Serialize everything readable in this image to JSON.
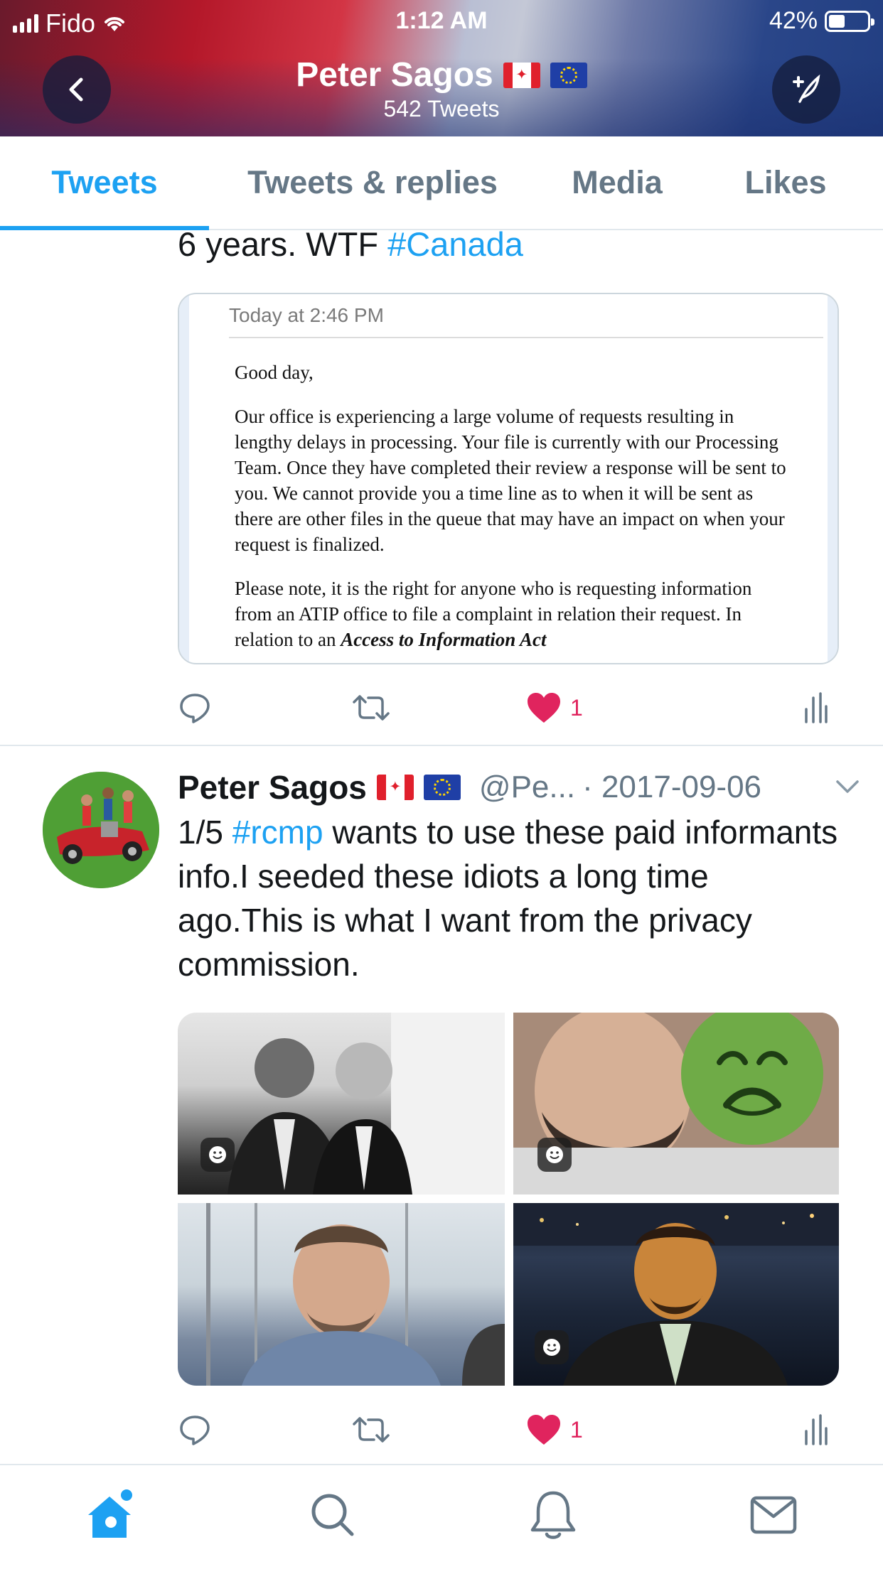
{
  "status_bar": {
    "carrier": "Fido",
    "time": "1:12 AM",
    "battery": "42%"
  },
  "header": {
    "name": "Peter Sagos",
    "tweet_count": "542 Tweets",
    "back_icon": "chevron-left-icon",
    "compose_icon": "compose-tweet-icon"
  },
  "tabs": {
    "items": [
      {
        "label": "Tweets",
        "active": true
      },
      {
        "label": "Tweets & replies",
        "active": false
      },
      {
        "label": "Media",
        "active": false
      },
      {
        "label": "Likes",
        "active": false
      }
    ]
  },
  "tweet1": {
    "text_start": "6 years. WTF ",
    "hashtag": "#Canada",
    "card": {
      "date": "Today at 2:46 PM",
      "greeting": "Good day,",
      "paragraph1": "Our office is experiencing a large volume of requests resulting in lengthy delays in processing. Your file is currently with our Processing Team. Once they have completed their review a response will be sent to you. We cannot provide you a time line as to when it will be sent as there are other files in the queue that may have an impact on when your request is finalized.",
      "paragraph2_start": "Please note, it is the right for anyone who is requesting information from an ATIP office to file a complaint in relation their request. In relation to an ",
      "paragraph2_emph": "Access to Information Act"
    },
    "like_count": "1"
  },
  "tweet2": {
    "name": "Peter Sagos",
    "handle": "@Pe...",
    "date": "· 2017-09-06",
    "text_prefix": "1/5 ",
    "hashtag": "#rcmp",
    "text_rest": " wants to use these paid informants info.I seeded these idiots a long time ago.This is what I want from the privacy commission.",
    "like_count": "1"
  },
  "colors": {
    "accent": "#1da1f2",
    "like": "#e0245e",
    "secondary_text": "#657786"
  },
  "bottom_nav": {
    "items": [
      "home-icon",
      "search-icon",
      "notifications-icon",
      "messages-icon"
    ]
  }
}
